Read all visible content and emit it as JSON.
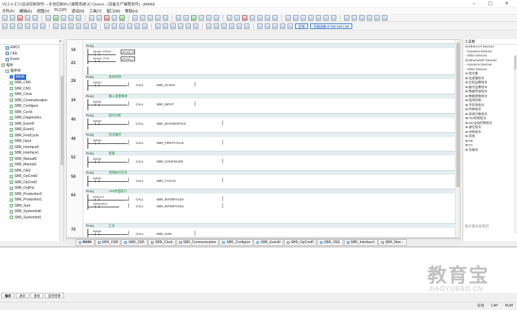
{
  "window": {
    "title": "V3.2.0 汇川运动控制软件 – 步进控制PLC编程系统 [C:\\Users\\...\\设备生产编程软件] - [MAIN]",
    "controls": "–   ▢   ✕"
  },
  "menu": [
    "文件(F)",
    "编辑(E)",
    "视图(V)",
    "PLC(P)",
    "调试(D)",
    "工具(T)",
    "窗口(W)",
    "帮助(H)"
  ],
  "toolbar2": {
    "status_box": "在线",
    "ip_box": "扫描设备 IP:192.168.1.88"
  },
  "left_tree": {
    "items": [
      {
        "label": "EMC1",
        "indent": 1,
        "icon": "blue"
      },
      {
        "label": "CEE",
        "indent": 1,
        "icon": "blue"
      },
      {
        "label": "Event",
        "indent": 1,
        "icon": "blue"
      },
      {
        "label": "程序",
        "indent": 0,
        "icon": "green"
      },
      {
        "label": "程序块",
        "indent": 1,
        "icon": "green"
      },
      {
        "label": "MAIN",
        "indent": 2,
        "icon": "sel",
        "selected": true
      },
      {
        "label": "SBR_CM0",
        "indent": 2
      },
      {
        "label": "SBR_CM1",
        "indent": 2
      },
      {
        "label": "SBR_Clock",
        "indent": 2
      },
      {
        "label": "SBR_Communication",
        "indent": 2
      },
      {
        "label": "SBR_Configure",
        "indent": 2
      },
      {
        "label": "SBR_Cyclic",
        "indent": 2
      },
      {
        "label": "SBR_Diagnostics",
        "indent": 2
      },
      {
        "label": "SBR_Event0",
        "indent": 2
      },
      {
        "label": "SBR_Event1",
        "indent": 2
      },
      {
        "label": "SBR_FirstCycle",
        "indent": 2
      },
      {
        "label": "SBR_Input",
        "indent": 2
      },
      {
        "label": "SBR_Interface0",
        "indent": 2
      },
      {
        "label": "SBR_Interface1",
        "indent": 2
      },
      {
        "label": "SBR_Manual0",
        "indent": 2
      },
      {
        "label": "SBR_Manual1",
        "indent": 2
      },
      {
        "label": "SBR_OEE",
        "indent": 2
      },
      {
        "label": "SBR_OpCmd0",
        "indent": 2
      },
      {
        "label": "SBR_OpCmd1",
        "indent": 2
      },
      {
        "label": "SBR_OutPut",
        "indent": 2
      },
      {
        "label": "SBR_Production0",
        "indent": 2
      },
      {
        "label": "SBR_Production1",
        "indent": 2
      },
      {
        "label": "SBR_Sum",
        "indent": 2
      },
      {
        "label": "SBR_Systemlnit0",
        "indent": 2
      },
      {
        "label": "SBR_Systemlnit1",
        "indent": 2
      }
    ]
  },
  "rungs": [
    {
      "num": "16",
      "net": "Rung",
      "comment": "",
      "contacts": [
        "sEvent_ENEW",
        "sEvent_TEW"
      ],
      "boxes": [
        "sEvent_R",
        "sEvent_L"
      ],
      "instr": "",
      "arg": ""
    },
    {
      "num": "22",
      "net": "",
      "comment": "",
      "contacts": [],
      "boxes": [],
      "instr": "",
      "arg": ""
    },
    {
      "num": "28",
      "net": "Rung",
      "comment": "系统时钟",
      "contacts": [
        "M8000"
      ],
      "boxes": [],
      "instr": "CALL",
      "arg": "SBR_CLOCK"
    },
    {
      "num": "34",
      "net": "Rung",
      "comment": "输入变量映射",
      "contacts": [
        "M8000"
      ],
      "boxes": [],
      "instr": "CALL",
      "arg": "SBR_INPUT"
    },
    {
      "num": "40",
      "net": "Rung",
      "comment": "操作诊断",
      "contacts": [
        "M8000"
      ],
      "boxes": [],
      "instr": "CALL",
      "arg": "SBR_DIAGNOSTICS"
    },
    {
      "num": "46",
      "net": "Rung",
      "comment": "首次循环",
      "contacts": [
        "M8000"
      ],
      "boxes": [],
      "instr": "CALL",
      "arg": "SBR_FIRSTCYCLE"
    },
    {
      "num": "52",
      "net": "Rung",
      "comment": "配置",
      "contacts": [
        "M8000"
      ],
      "boxes": [],
      "instr": "CALL",
      "arg": "SBR_CONFIGURE"
    },
    {
      "num": "58",
      "net": "Rung",
      "comment": "周期执行任务",
      "contacts": [
        "M8000"
      ],
      "boxes": [],
      "instr": "CALL",
      "arg": "SBR_CYCLIC"
    },
    {
      "num": "64",
      "net": "Rung",
      "comment": "HMI界面接口",
      "contacts": [
        "sFlyCom",
        "sSimulation"
      ],
      "boxes": [],
      "instr": "CALL",
      "arg": "SBR_INTERFACE0"
    },
    {
      "num": "70",
      "net": "Rung",
      "comment": "汇总",
      "contacts": [
        "M8000"
      ],
      "boxes": [],
      "instr": "CALL",
      "arg": "SBR_SUM"
    }
  ],
  "second_call_arg": "SBR_INTERFACE1",
  "tabs": [
    "MAIN",
    "SBR_CM0",
    "SBR_CM1",
    "SBR_Clock",
    "SBR_Communication",
    "SBR_Configure",
    "SBR_Event0",
    "SBR_OpCmd0",
    "SBR_OEE",
    "SBR_Interface1",
    "SBR_Man..."
  ],
  "right_pane": {
    "title": "工具箱",
    "items": [
      "⊟ EtherCAT Devices",
      "   ◦ Inovance Devices",
      "   ◦ Other Devices",
      "⊟ EtherNet/IP Devices",
      "   ◦ Inovance Devices",
      "   ◦ Other Devices",
      "⊟ 指令集",
      "   ⊞ 位逻辑指令",
      "   ⊞ 比较运算指令",
      "   ⊞ 触点运算指令",
      "   ⊞ 数据传送指令",
      "   ⊞ 数据转换指令",
      "   ⊞ 程序控制",
      "   ⊞ 字符串指令",
      "   ⊞ 时钟指令",
      "   ⊞ 高速计数指令",
      "   ⊞ PID控制指令",
      "   ⊞ MC运动控制指令",
      "   ⊞ 通信指令",
      "   ⊞ 中断指令",
      "   ⊞ 其他",
      "⊞ FB",
      "⊞ FC",
      "⊞ 功能块"
    ],
    "footer": "指令语示会查阅"
  },
  "bottom_tabs": [
    "编译",
    "通讯",
    "查找",
    "监控结果"
  ],
  "status": {
    "mode": "在线",
    "cap": "CAP",
    "num": "NUM"
  },
  "watermark": {
    "main": "教育宝",
    "sub": "JIAOYUBAO.CN"
  }
}
